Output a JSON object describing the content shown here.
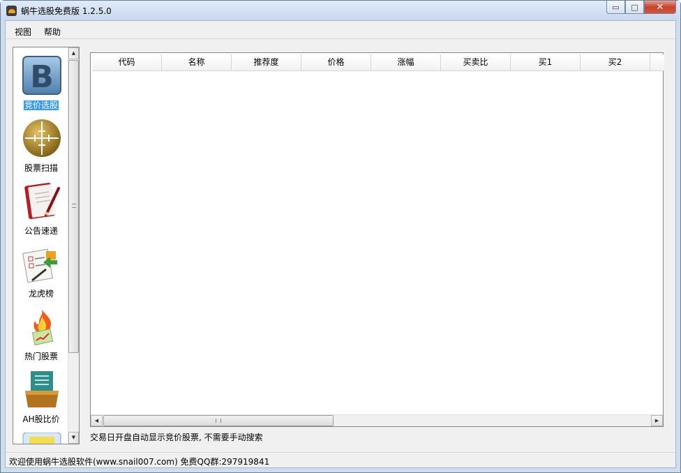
{
  "window": {
    "title": "蜗牛选股免费版 1.2.5.0",
    "controls": {
      "minimize": "▭",
      "maximize": "□",
      "close": "✕"
    }
  },
  "menu": {
    "items": [
      "视图",
      "帮助"
    ]
  },
  "nav": {
    "items": [
      {
        "label": "竞价选股",
        "icon": "letter-b-icon",
        "selected": true
      },
      {
        "label": "股票扫描",
        "icon": "crosshair-target-icon",
        "selected": false
      },
      {
        "label": "公告速递",
        "icon": "notebook-pen-icon",
        "selected": false
      },
      {
        "label": "龙虎榜",
        "icon": "checklist-arrow-icon",
        "selected": false
      },
      {
        "label": "热门股票",
        "icon": "flame-chart-icon",
        "selected": false
      },
      {
        "label": "AH股比价",
        "icon": "folder-box-icon",
        "selected": false
      },
      {
        "label": "",
        "icon": "sticky-note-icon",
        "selected": false
      }
    ]
  },
  "table": {
    "columns": [
      "代码",
      "名称",
      "推荐度",
      "价格",
      "涨幅",
      "买卖比",
      "买1",
      "买2"
    ],
    "rows": []
  },
  "hint": "交易日开盘自动显示竞价股票, 不需要手动搜索",
  "status": "欢迎使用蜗牛选股软件(www.snail007.com) 免费QQ群:297919841",
  "colors": {
    "selection": "#3399ff",
    "window_frame": "#cfdeef",
    "close_button": "#c7432c"
  }
}
